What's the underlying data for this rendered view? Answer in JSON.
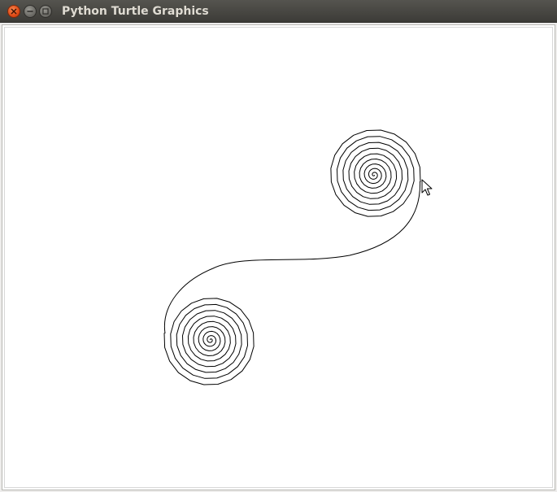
{
  "window": {
    "title": "Python Turtle Graphics",
    "buttons": [
      {
        "name": "close",
        "icon": "close-icon",
        "color": "#df4a16"
      },
      {
        "name": "minimize",
        "icon": "minimize-icon",
        "color": "#6d6c67"
      },
      {
        "name": "maximize",
        "icon": "maximize-icon",
        "color": "#6d6c67"
      }
    ]
  },
  "canvas": {
    "background": "#ffffff",
    "drawing": "double-spiral",
    "pen_color": "#000000",
    "cursor": "arrow-cursor-icon"
  }
}
